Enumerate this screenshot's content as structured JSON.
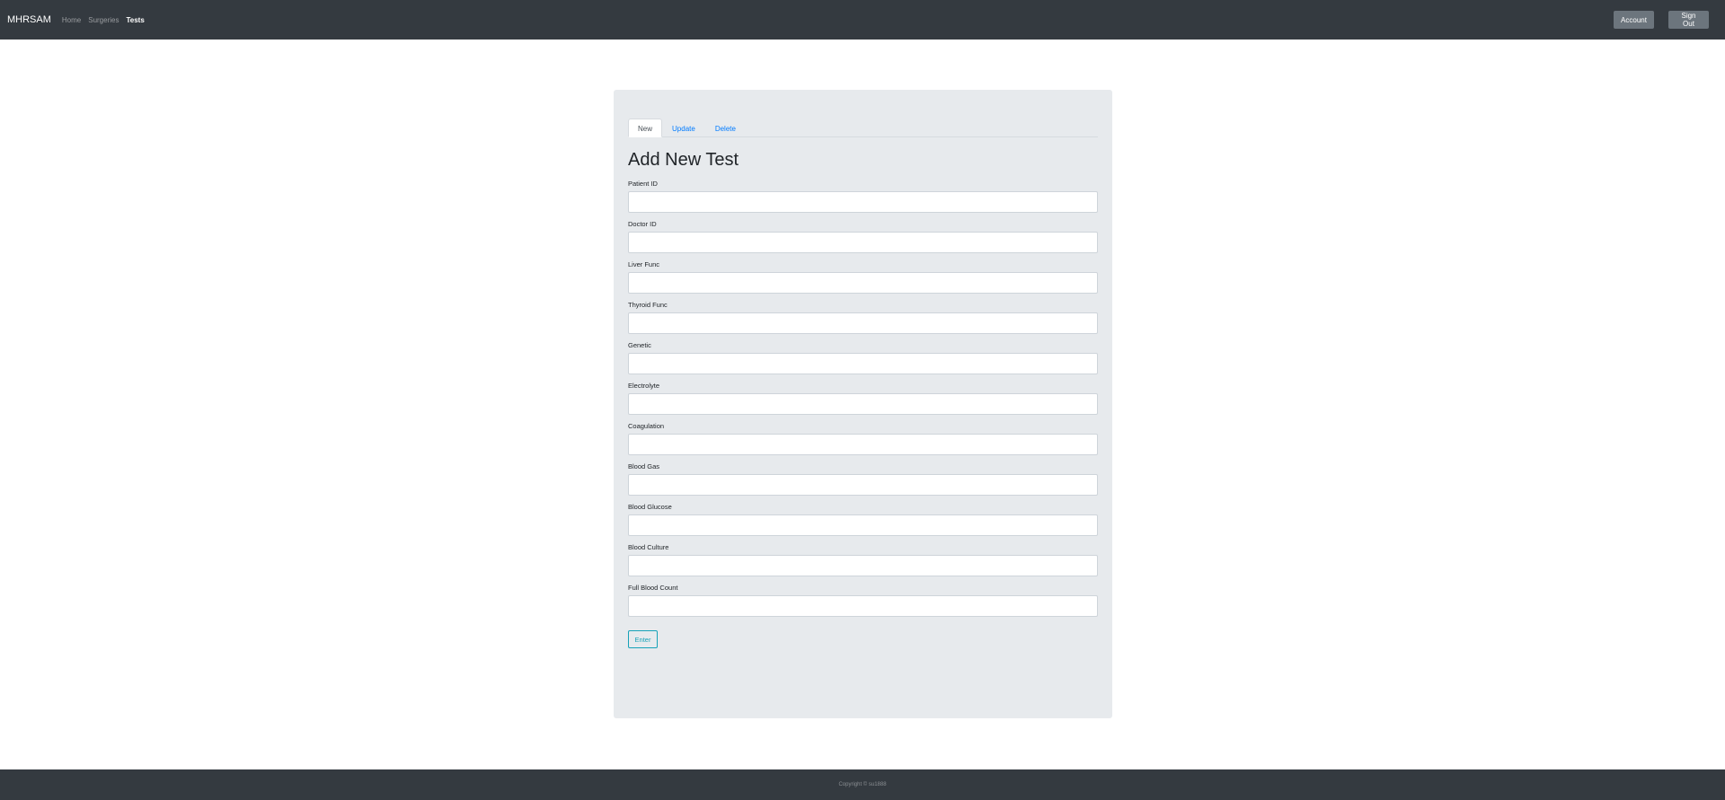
{
  "nav": {
    "brand": "MHRSAM",
    "links": [
      {
        "label": "Home"
      },
      {
        "label": "Surgeries"
      },
      {
        "label": "Tests"
      }
    ],
    "account_label": "Account",
    "signout_label": "Sign Out"
  },
  "tabs": [
    {
      "label": "New"
    },
    {
      "label": "Update"
    },
    {
      "label": "Delete"
    }
  ],
  "form": {
    "title": "Add New Test",
    "fields": [
      {
        "label": "Patient ID",
        "value": ""
      },
      {
        "label": "Doctor ID",
        "value": ""
      },
      {
        "label": "Liver Func",
        "value": ""
      },
      {
        "label": "Thyroid Func",
        "value": ""
      },
      {
        "label": "Genetic",
        "value": ""
      },
      {
        "label": "Electrolyte",
        "value": ""
      },
      {
        "label": "Coagulation",
        "value": ""
      },
      {
        "label": "Blood Gas",
        "value": ""
      },
      {
        "label": "Blood Glucose",
        "value": ""
      },
      {
        "label": "Blood Culture",
        "value": ""
      },
      {
        "label": "Full Blood Count",
        "value": ""
      }
    ],
    "submit_label": "Enter"
  },
  "footer": {
    "text": "Copyright © su1888"
  },
  "colors": {
    "navbar": "#343a40",
    "card": "#e7eaed",
    "link": "#007bff",
    "submit": "#17a2b8"
  }
}
